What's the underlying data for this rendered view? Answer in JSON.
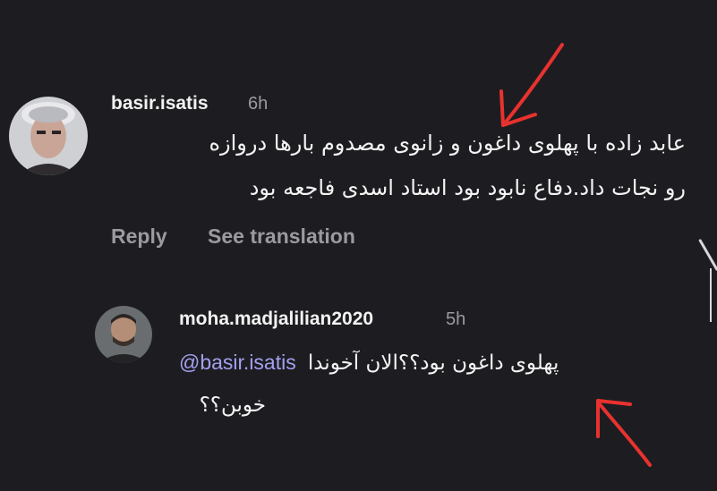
{
  "comment": {
    "username": "basir.isatis",
    "time": "6h",
    "text_line1": "عابد زاده با پهلوی داغون و زانوی مصدوم بارها دروازه",
    "text_line2": "رو نجات داد.دفاع نابود بود استاد اسدی فاجعه بود",
    "reply_label": "Reply",
    "translate_label": "See translation"
  },
  "reply": {
    "username": "moha.madjalilian2020",
    "time": "5h",
    "mention": "@basir.isatis",
    "text_line1": "پهلوی داغون بود؟؟الان آخوندا",
    "text_line2": "خوبن؟؟"
  },
  "colors": {
    "background": "#1d1d21",
    "annotation_arrow": "#e8322f",
    "mention": "#a4a0f0"
  },
  "icons": [
    "user-avatar",
    "user-avatar",
    "annotation-arrow",
    "annotation-arrow"
  ]
}
